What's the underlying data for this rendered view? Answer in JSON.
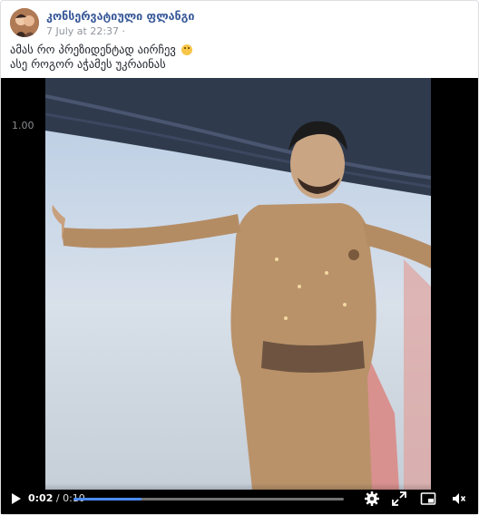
{
  "post": {
    "page_name": "კონსერვატიული ფლანგი",
    "timestamp": "7 July at 22:37 ·",
    "lines": [
      "ამას რო პრეზიდენტად აირჩევ",
      "ასე როგორ აჭამეს უკრაინას"
    ],
    "emoji": "slightly-smiling-face-icon"
  },
  "video": {
    "view_counter": "1.00",
    "current_time": "0:02",
    "separator": " / ",
    "duration": "0:10",
    "progress": 0.25,
    "controls": [
      "play-icon",
      "gear-icon",
      "expand-icon",
      "picture-in-picture-icon",
      "volume-icon"
    ],
    "accent_color": "#4b8cff"
  }
}
